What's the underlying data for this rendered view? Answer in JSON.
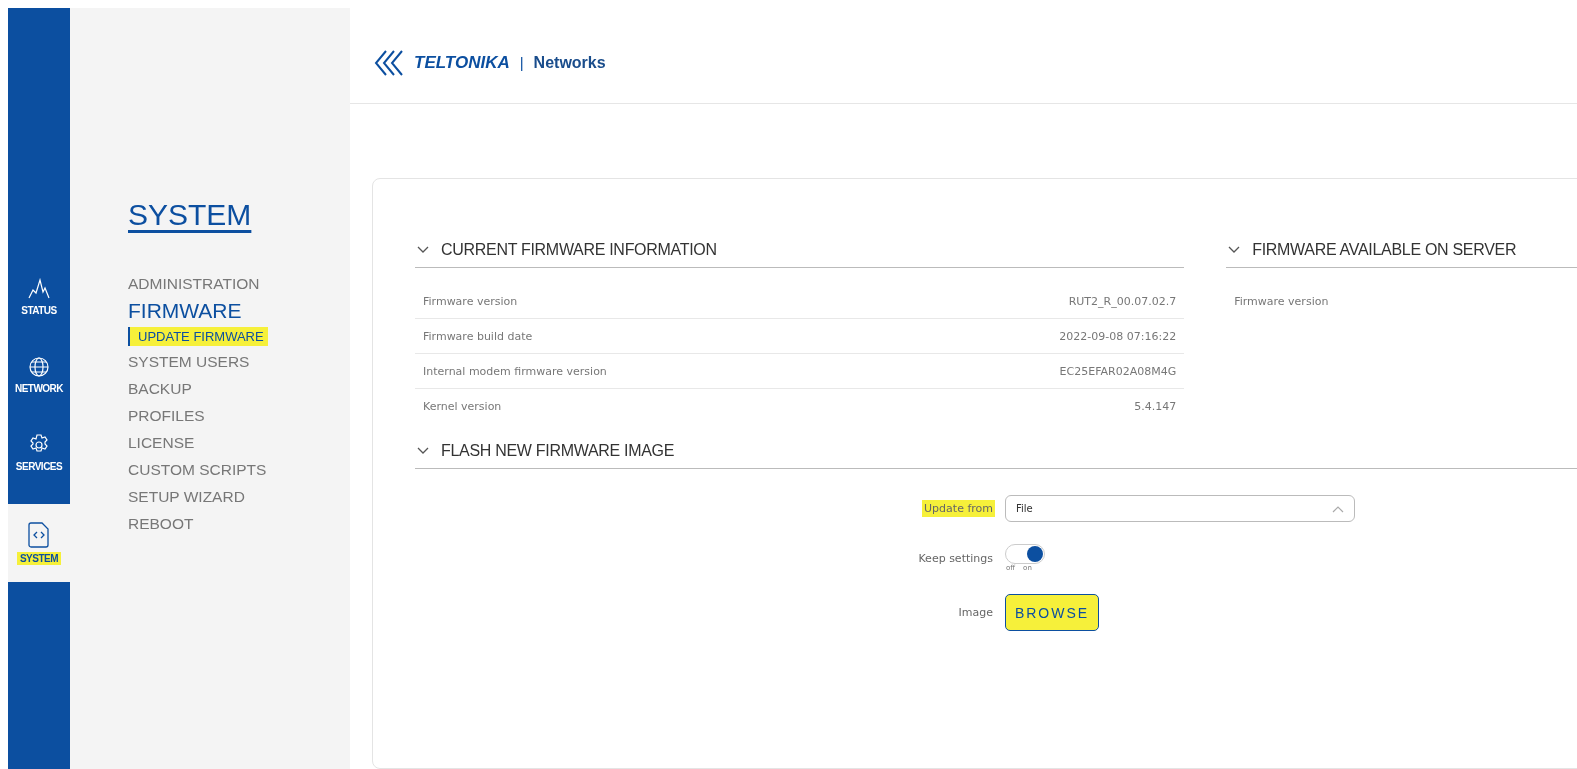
{
  "nav_rail": [
    {
      "kind": "status",
      "label": "STATUS",
      "selected": false,
      "highlighted": false
    },
    {
      "kind": "network",
      "label": "NETWORK",
      "selected": false,
      "highlighted": false
    },
    {
      "kind": "services",
      "label": "SERVICES",
      "selected": false,
      "highlighted": false
    },
    {
      "kind": "system",
      "label": "SYSTEM",
      "selected": true,
      "highlighted": true
    }
  ],
  "sidebar": {
    "title": "SYSTEM",
    "items": [
      {
        "label": "ADMINISTRATION",
        "selected": false,
        "highlighted": false
      },
      {
        "label": "FIRMWARE",
        "selected": true,
        "highlighted": false,
        "children": [
          {
            "label": "UPDATE FIRMWARE",
            "selected": true,
            "highlighted": true
          }
        ]
      },
      {
        "label": "SYSTEM USERS",
        "selected": false,
        "highlighted": false
      },
      {
        "label": "BACKUP",
        "selected": false,
        "highlighted": false
      },
      {
        "label": "PROFILES",
        "selected": false,
        "highlighted": false
      },
      {
        "label": "LICENSE",
        "selected": false,
        "highlighted": false
      },
      {
        "label": "CUSTOM SCRIPTS",
        "selected": false,
        "highlighted": false
      },
      {
        "label": "SETUP WIZARD",
        "selected": false,
        "highlighted": false
      },
      {
        "label": "REBOOT",
        "selected": false,
        "highlighted": false
      }
    ]
  },
  "header": {
    "brand": "TELTONIKA",
    "separator": "|",
    "product": "Networks"
  },
  "current_firmware": {
    "title": "CURRENT FIRMWARE INFORMATION",
    "expanded": true,
    "rows": [
      {
        "label": "Firmware version",
        "value": "RUT2_R_00.07.02.7"
      },
      {
        "label": "Firmware build date",
        "value": "2022-09-08 07:16:22"
      },
      {
        "label": "Internal modem firmware version",
        "value": "EC25EFAR02A08M4G"
      },
      {
        "label": "Kernel version",
        "value": "5.4.147"
      }
    ]
  },
  "server_firmware": {
    "title": "FIRMWARE AVAILABLE ON SERVER",
    "expanded": true,
    "rows": [
      {
        "label": "Firmware version"
      }
    ]
  },
  "flash": {
    "title": "FLASH NEW FIRMWARE IMAGE",
    "expanded": true,
    "update_from": {
      "label": "Update from",
      "value": "File",
      "highlighted": true
    },
    "keep_settings": {
      "label": "Keep settings",
      "on": true,
      "off_label": "off",
      "on_label": "on"
    },
    "image": {
      "label": "Image",
      "button": "BROWSE",
      "highlighted": true
    }
  }
}
